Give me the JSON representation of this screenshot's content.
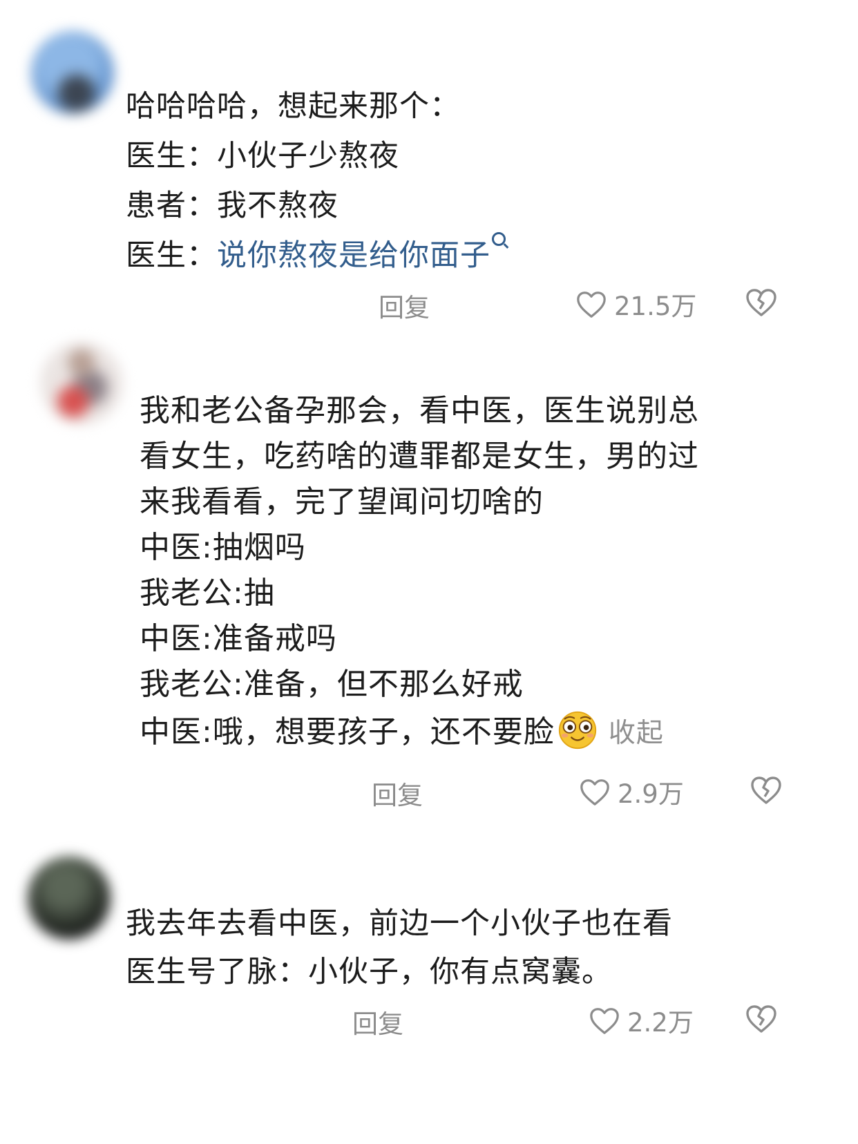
{
  "comments": [
    {
      "lines": [
        {
          "text": "哈哈哈哈，想起来那个："
        },
        {
          "text": "医生：小伙子少熬夜"
        },
        {
          "text": "患者：我不熬夜"
        },
        {
          "text": "医生：",
          "link": "说你熬夜是给你面子"
        }
      ],
      "reply_label": "回复",
      "likes": "21.5万"
    },
    {
      "lines": [
        {
          "text": "我和老公备孕那会，看中医，医生说别总"
        },
        {
          "text": "看女生，吃药啥的遭罪都是女生，男的过"
        },
        {
          "text": "来我看看，完了望闻问切啥的"
        },
        {
          "text": "中医:抽烟吗"
        },
        {
          "text": "我老公:抽"
        },
        {
          "text": "中医:准备戒吗"
        },
        {
          "text": "我老公:准备，但不那么好戒"
        },
        {
          "text": "中医:哦，想要孩子，还不要脸"
        }
      ],
      "collapse_label": "收起",
      "reply_label": "回复",
      "likes": "2.9万"
    },
    {
      "lines": [
        {
          "text": "我去年去看中医，前边一个小伙子也在看"
        },
        {
          "text": "医生号了脉：小伙子，你有点窝囊。"
        }
      ],
      "reply_label": "回复",
      "likes": "2.2万"
    }
  ],
  "icons": {
    "like": "heart-outline-icon",
    "dislike": "broken-heart-icon",
    "search": "search-icon",
    "emoji": "smiling-emoji-icon"
  },
  "colors": {
    "text": "#1c1c1c",
    "link": "#325d8c",
    "muted": "#8c8c8c",
    "background": "#ffffff"
  }
}
